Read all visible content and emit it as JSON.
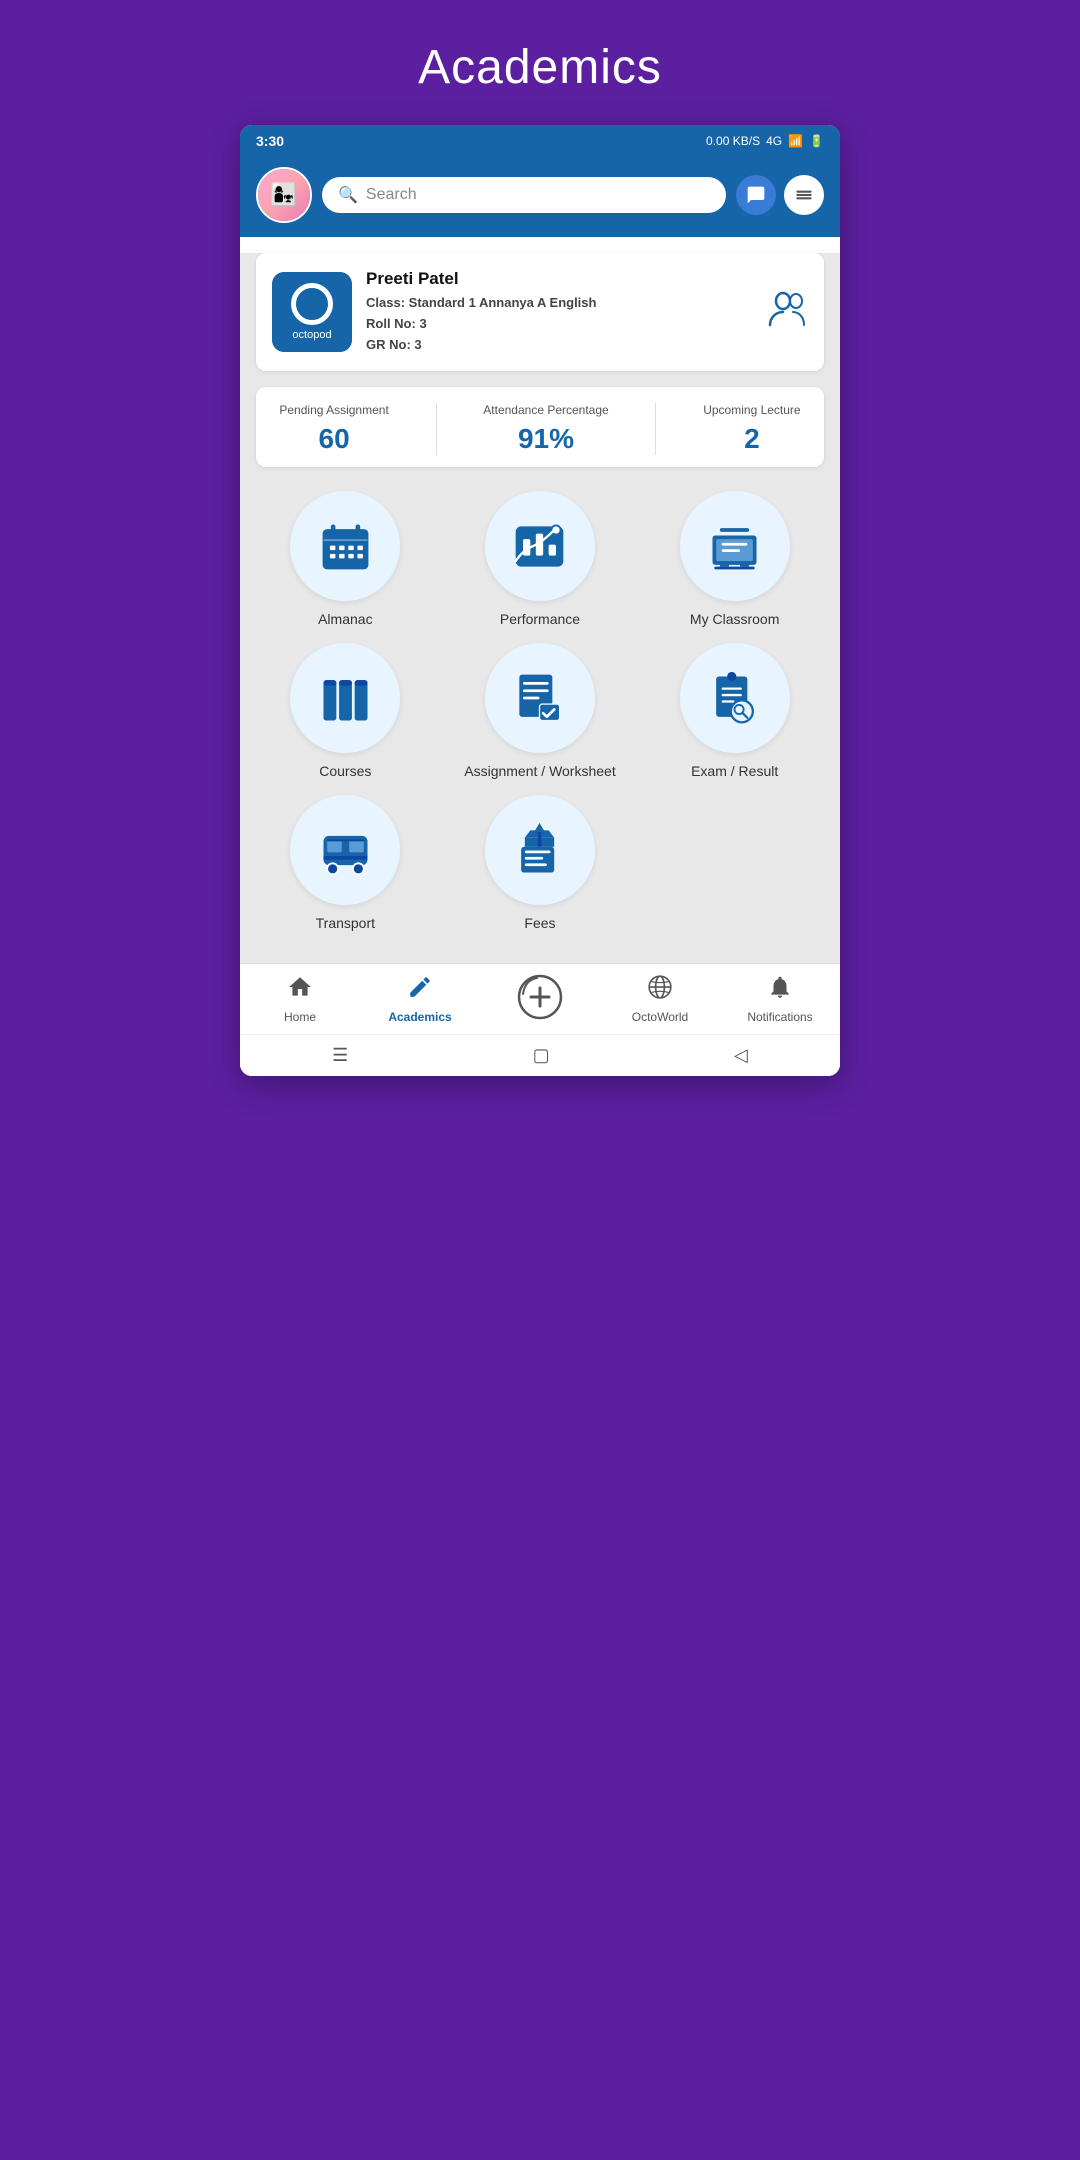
{
  "page": {
    "title": "Academics"
  },
  "statusBar": {
    "time": "3:30",
    "networkInfo": "0.00 KB/S",
    "networkType": "4G"
  },
  "header": {
    "searchPlaceholder": "Search",
    "searchLabel": "🔍 Search"
  },
  "profile": {
    "name": "Preeti Patel",
    "classLabel": "Class:",
    "classValue": "Standard 1 Annanya A English",
    "rollLabel": "Roll No:",
    "rollValue": "3",
    "grLabel": "GR No:",
    "grValue": "3"
  },
  "stats": {
    "pendingLabel": "Pending Assignment",
    "pendingValue": "60",
    "attendanceLabel": "Attendance Percentage",
    "attendanceValue": "91%",
    "upcomingLabel": "Upcoming Lecture",
    "upcomingValue": "2"
  },
  "grid": [
    {
      "id": "almanac",
      "label": "Almanac"
    },
    {
      "id": "performance",
      "label": "Performance"
    },
    {
      "id": "my-classroom",
      "label": "My Classroom"
    },
    {
      "id": "courses",
      "label": "Courses"
    },
    {
      "id": "assignment-worksheet",
      "label": "Assignment / Worksheet"
    },
    {
      "id": "exam-result",
      "label": "Exam / Result"
    },
    {
      "id": "transport",
      "label": "Transport"
    },
    {
      "id": "fees",
      "label": "Fees"
    }
  ],
  "bottomNav": [
    {
      "id": "home",
      "label": "Home",
      "active": false
    },
    {
      "id": "academics",
      "label": "Academics",
      "active": true
    },
    {
      "id": "octoworld-plus",
      "label": "",
      "active": false
    },
    {
      "id": "octoworld",
      "label": "OctoWorld",
      "active": false
    },
    {
      "id": "notifications",
      "label": "Notifications",
      "active": false
    }
  ]
}
